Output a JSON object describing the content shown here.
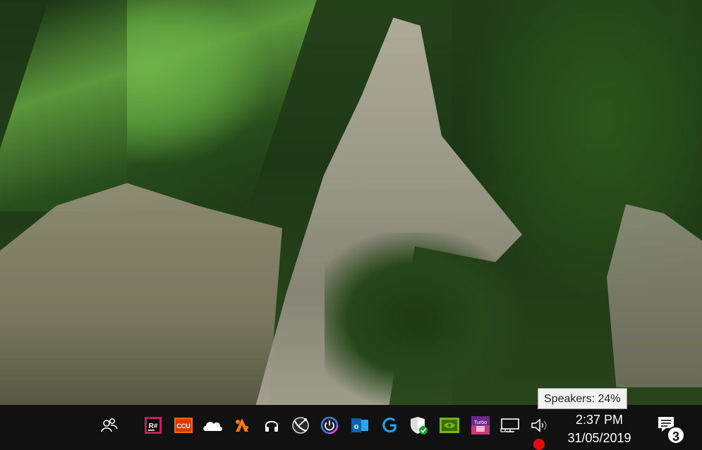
{
  "tooltip": {
    "text": "Speakers: 24%"
  },
  "taskbar": {
    "tray_icons": [
      {
        "name": "people-icon"
      },
      {
        "name": "resharper-icon",
        "label": "R#"
      },
      {
        "name": "ccu-icon",
        "label": "CCU"
      },
      {
        "name": "onedrive-icon"
      },
      {
        "name": "avast-icon"
      },
      {
        "name": "headphones-icon"
      },
      {
        "name": "satellite-dish-icon"
      },
      {
        "name": "power-app-icon"
      },
      {
        "name": "outlook-icon",
        "label": "o"
      },
      {
        "name": "logitech-g-icon"
      },
      {
        "name": "windows-security-icon"
      },
      {
        "name": "nvidia-icon"
      },
      {
        "name": "turbo-app-icon",
        "label": "Turbo"
      },
      {
        "name": "network-icon"
      },
      {
        "name": "speaker-icon"
      }
    ],
    "clock": {
      "time": "2:37 PM",
      "date": "31/05/2019"
    },
    "notifications": {
      "count": "3"
    }
  },
  "colors": {
    "taskbar": "#111111",
    "record_indicator": "#e30b0b",
    "tooltip_bg": "#f2f2f2"
  }
}
